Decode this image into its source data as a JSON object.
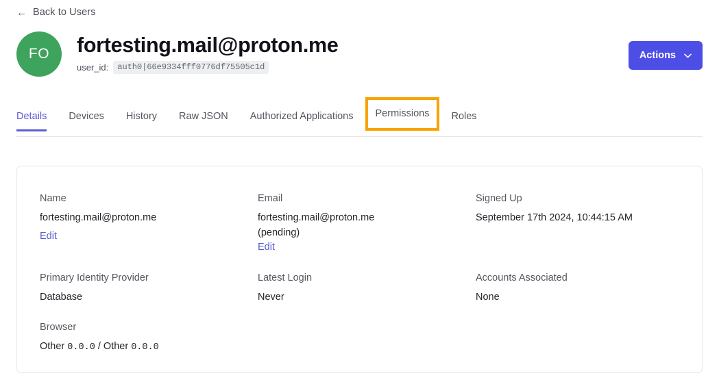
{
  "nav": {
    "back_label": "Back to Users",
    "back_icon": "arrow-left-icon"
  },
  "header": {
    "avatar_initials": "FO",
    "avatar_color": "#3da35d",
    "title": "fortesting.mail@proton.me",
    "user_id_label": "user_id:",
    "user_id_value": "auth0|66e9334fff0776df75505c1d",
    "actions_label": "Actions",
    "actions_icon": "chevron-down-icon",
    "actions_color": "#4c4ee6"
  },
  "tabs": {
    "active_color": "#5b5bd6",
    "highlight_color": "#f9a301",
    "items": [
      {
        "label": "Details",
        "state": "active"
      },
      {
        "label": "Devices",
        "state": "default"
      },
      {
        "label": "History",
        "state": "default"
      },
      {
        "label": "Raw JSON",
        "state": "default"
      },
      {
        "label": "Authorized Applications",
        "state": "default"
      },
      {
        "label": "Permissions",
        "state": "highlighted"
      },
      {
        "label": "Roles",
        "state": "default"
      }
    ]
  },
  "details": {
    "name": {
      "label": "Name",
      "value": "fortesting.mail@proton.me",
      "edit_label": "Edit"
    },
    "email": {
      "label": "Email",
      "value": "fortesting.mail@proton.me",
      "status": "(pending)",
      "edit_label": "Edit"
    },
    "signed_up": {
      "label": "Signed Up",
      "value": "September 17th 2024, 10:44:15 AM"
    },
    "identity_provider": {
      "label": "Primary Identity Provider",
      "value": "Database"
    },
    "latest_login": {
      "label": "Latest Login",
      "value": "Never"
    },
    "accounts_associated": {
      "label": "Accounts Associated",
      "value": "None"
    },
    "browser": {
      "label": "Browser",
      "value_prefix": "Other ",
      "value_version_1": "0.0.0",
      "value_separator": " / Other ",
      "value_version_2": "0.0.0"
    }
  }
}
